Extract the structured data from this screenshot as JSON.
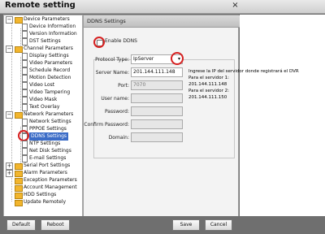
{
  "window": {
    "title": "Remote setting",
    "close": "×"
  },
  "tree": {
    "sections": [
      {
        "label": "Device Parameters",
        "children": [
          "Device Information",
          "Version Information",
          "DST Settings"
        ]
      },
      {
        "label": "Channel Parameters",
        "children": [
          "Display Settings",
          "Video Parameters",
          "Schedule Record",
          "Motion Detection",
          "Video Lost",
          "Video Tampering",
          "Video Mask",
          "Text Overlay"
        ]
      },
      {
        "label": "Network Parameters",
        "children": [
          "Network Settings",
          "PPPOE Settings",
          "DDNS Settings",
          "NTP Settings",
          "Net Disk Settings",
          "E-mail Settings"
        ]
      },
      {
        "label": "Serial Port Settings",
        "children": []
      },
      {
        "label": "Alarm Parameters",
        "children": []
      },
      {
        "label": "Exception Parameters",
        "children": []
      },
      {
        "label": "Account Management",
        "children": []
      },
      {
        "label": "HDD Settings",
        "children": []
      },
      {
        "label": "Update Remotely",
        "children": []
      }
    ],
    "selected": "DDNS Settings"
  },
  "panel": {
    "header": "DDNS Settings",
    "enable_label": "Enable DDNS",
    "fields": {
      "protocol_label": "Protocol Type:",
      "protocol_value": "IpServer",
      "server_label": "Server Name:",
      "server_value": "201.144.111.148",
      "port_label": "Port:",
      "port_value": "7070",
      "username_label": "User name:",
      "password_label": "Password:",
      "confirm_label": "Confirm Password:",
      "domain_label": "Domain:"
    }
  },
  "annotation": {
    "line1": "Ingrese la IP del servidor donde registrará el DVR",
    "line2": "Para el servidor 1:",
    "line3": "201.144.111.148",
    "line4": "Para el servidor 2:",
    "line5": "201.144.111.150"
  },
  "footer": {
    "default": "Default",
    "reboot": "Reboot",
    "save": "Save",
    "cancel": "Cancel"
  },
  "colors": {
    "selection": "#3b6cc7",
    "highlight_circle": "#d62020"
  }
}
